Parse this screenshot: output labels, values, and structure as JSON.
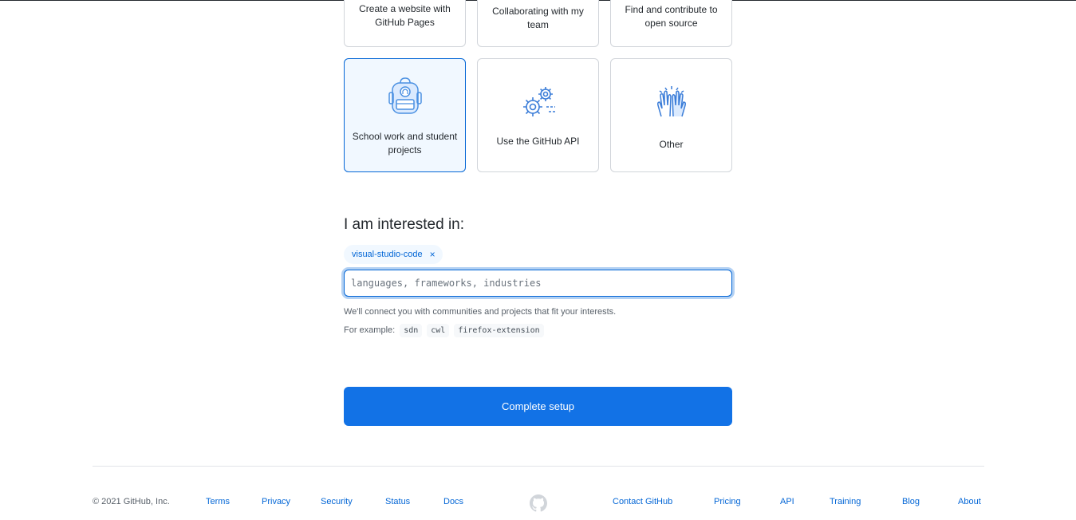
{
  "cards": [
    {
      "label_line1": "Create a website with",
      "label_line2": "GitHub Pages"
    },
    {
      "label_line1": "Collaborating with my",
      "label_line2": "team"
    },
    {
      "label_line1": "Find and contribute to",
      "label_line2": "open source"
    },
    {
      "label_line1": "School work and student",
      "label_line2": "projects",
      "icon": "backpack-icon",
      "selected": true
    },
    {
      "label_line1": "Use the GitHub API",
      "icon": "gears-icon"
    },
    {
      "label_line1": "Other",
      "icon": "high-five-icon"
    }
  ],
  "interests": {
    "title": "I am interested in:",
    "selected_tags": [
      "visual-studio-code"
    ],
    "remove_symbol": "×",
    "input_value": "",
    "input_placeholder": "languages, frameworks, industries",
    "hint": "We'll connect you with communities and projects that fit your interests.",
    "example_label": "For example:",
    "examples": [
      "sdn",
      "cwl",
      "firefox-extension"
    ]
  },
  "complete_button": "Complete setup",
  "footer": {
    "copyright": "© 2021 GitHub, Inc.",
    "left_links": [
      "Terms",
      "Privacy",
      "Security",
      "Status",
      "Docs"
    ],
    "logo_icon": "github-mark-icon",
    "right_links": [
      "Contact GitHub",
      "Pricing",
      "API",
      "Training",
      "Blog",
      "About"
    ]
  },
  "colors": {
    "accent": "#0366d6",
    "button": "#1272e6",
    "selected_card_bg": "#f1f8ff",
    "border": "#d1d5da"
  }
}
